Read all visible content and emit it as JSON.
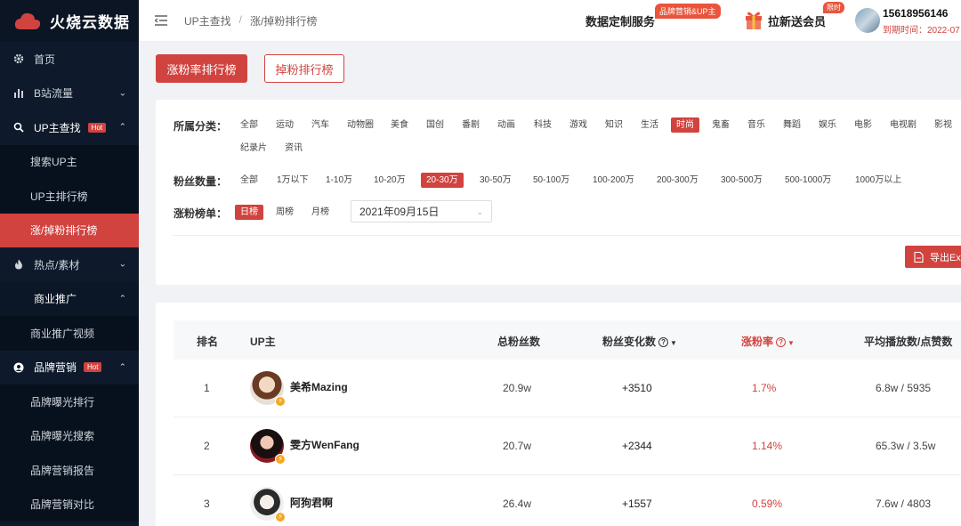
{
  "brand": {
    "name": "火烧云数据"
  },
  "sidebar": {
    "items": [
      {
        "label": "首页",
        "icon": "gear-icon"
      },
      {
        "label": "B站流量",
        "icon": "bar-chart-icon"
      },
      {
        "label": "UP主查找",
        "icon": "search-icon",
        "badge": "Hot"
      },
      {
        "label": "搜索UP主"
      },
      {
        "label": "UP主排行榜"
      },
      {
        "label": "涨/掉粉排行榜"
      },
      {
        "label": "热点/素材",
        "icon": "flame-icon"
      },
      {
        "label": "商业推广"
      },
      {
        "label": "商业推广视频"
      },
      {
        "label": "品牌营销",
        "icon": "brand-icon",
        "badge": "Hot"
      },
      {
        "label": "品牌曝光排行"
      },
      {
        "label": "品牌曝光搜索"
      },
      {
        "label": "品牌营销报告"
      },
      {
        "label": "品牌营销对比"
      }
    ]
  },
  "header": {
    "breadcrumb": [
      "UP主查找",
      "/",
      "涨/掉粉排行榜"
    ],
    "custom_service": "数据定制服务",
    "custom_badge": "品牌营销&UP主",
    "invite": "拉新送会员",
    "limit_badge": "限时",
    "user": "15618956146",
    "expire": "到期时间：2022-07"
  },
  "tabs": {
    "rate": "涨粉率排行榜",
    "lose": "掉粉排行榜"
  },
  "filters": {
    "category_label": "所属分类：",
    "categories": [
      "全部",
      "运动",
      "汽车",
      "动物圈",
      "美食",
      "国创",
      "番剧",
      "动画",
      "科技",
      "游戏",
      "知识",
      "生活",
      "时尚",
      "鬼畜",
      "音乐",
      "舞蹈",
      "娱乐",
      "电影",
      "电视剧",
      "影视",
      "纪录片",
      "资讯"
    ],
    "category_selected": "时尚",
    "fans_label": "粉丝数量：",
    "fans": [
      "全部",
      "1万以下",
      "1-10万",
      "10-20万",
      "20-30万",
      "30-50万",
      "50-100万",
      "100-200万",
      "200-300万",
      "300-500万",
      "500-1000万",
      "1000万以上"
    ],
    "fans_selected": "20-30万",
    "rank_label": "涨粉榜单：",
    "rank_types": [
      "日榜",
      "周榜",
      "月榜"
    ],
    "rank_selected": "日榜",
    "date": "2021年09月15日",
    "export": "导出Ex"
  },
  "table": {
    "headers": {
      "rank": "排名",
      "up": "UP主",
      "total": "总粉丝数",
      "change": "粉丝变化数",
      "rate": "涨粉率",
      "avg": "平均播放数/点赞数"
    },
    "rows": [
      {
        "rank": "1",
        "name": "美希Mazing",
        "total": "20.9w",
        "change": "+3510",
        "rate": "1.7%",
        "avg": "6.8w / 5935"
      },
      {
        "rank": "2",
        "name": "雯方WenFang",
        "total": "20.7w",
        "change": "+2344",
        "rate": "1.14%",
        "avg": "65.3w / 3.5w"
      },
      {
        "rank": "3",
        "name": "阿狗君啊",
        "total": "26.4w",
        "change": "+1557",
        "rate": "0.59%",
        "avg": "7.6w / 4803"
      }
    ]
  }
}
